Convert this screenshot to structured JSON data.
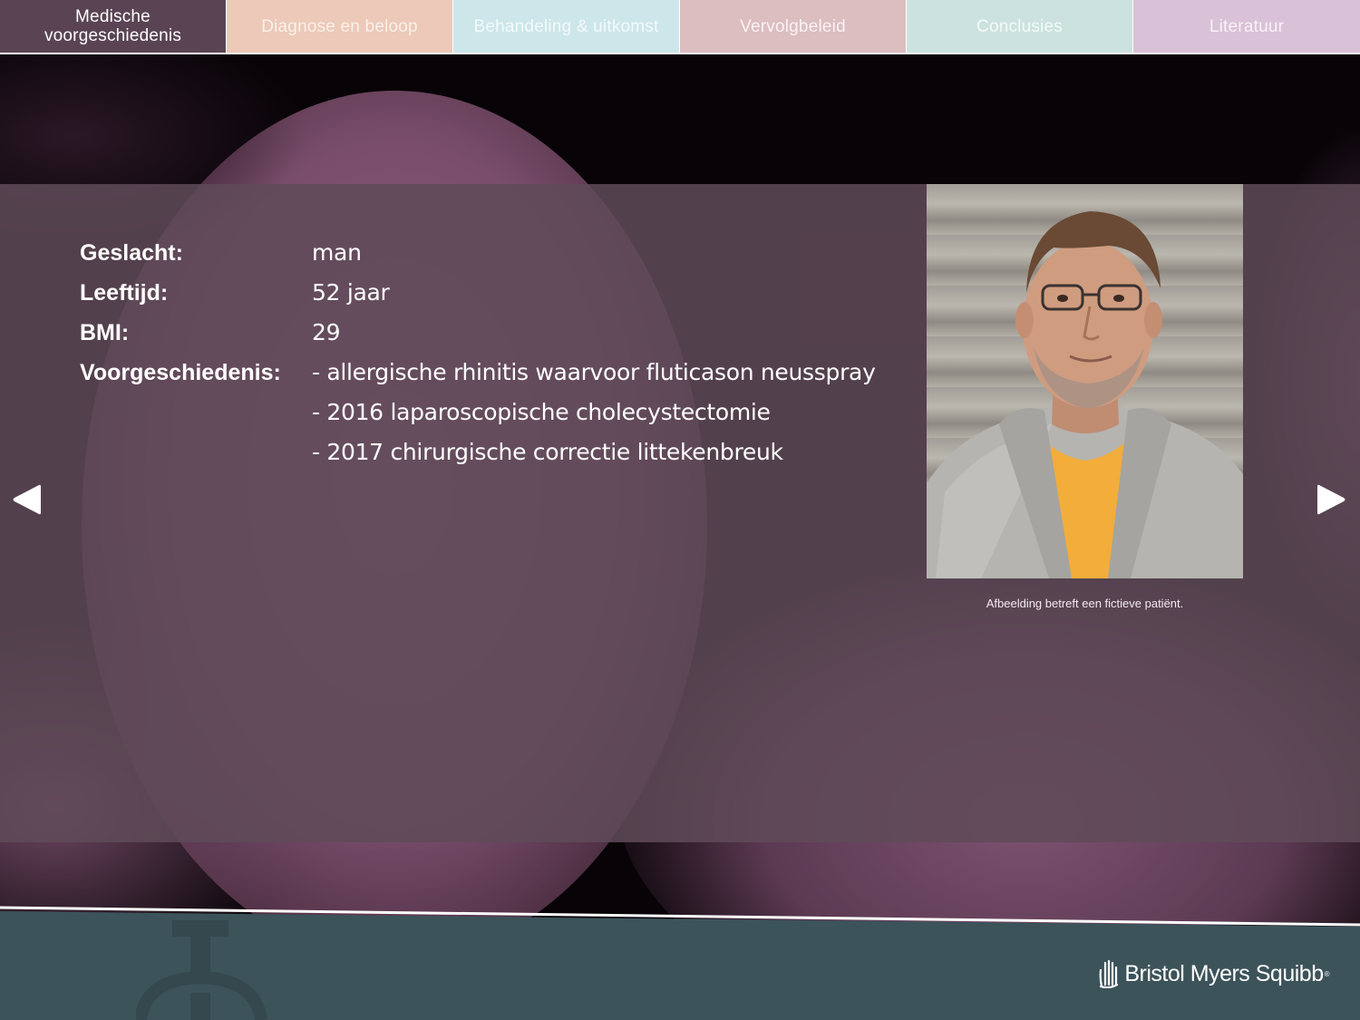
{
  "nav": {
    "tabs": [
      {
        "label": "Medische\nvoorgeschiedenis",
        "active": true
      },
      {
        "label": "Diagnose en beloop",
        "active": false
      },
      {
        "label": "Behandeling & uitkomst",
        "active": false
      },
      {
        "label": "Vervolgbeleid",
        "active": false
      },
      {
        "label": "Conclusies",
        "active": false
      },
      {
        "label": "Literatuur",
        "active": false
      }
    ]
  },
  "patient": {
    "gender_label": "Geslacht:",
    "gender_value": "man",
    "age_label": "Leeftijd:",
    "age_value": "52 jaar",
    "bmi_label": "BMI:",
    "bmi_value": "29",
    "history_label": "Voorgeschiedenis:",
    "history": [
      "- allergische rhinitis waarvoor fluticason neusspray",
      "- 2016 laparoscopische cholecystectomie",
      "- 2017 chirurgische correctie littekenbreuk"
    ],
    "photo_caption": "Afbeelding betreft een fictieve patiënt."
  },
  "footer": {
    "brand": "Bristol Myers Squibb",
    "brand_mark": "®"
  },
  "colors": {
    "panel": "#604a58",
    "footer": "#3c535a",
    "tab_active": "#5a4453",
    "tab_diagnose": "#ecc9b8",
    "tab_behandeling": "#cde6ea",
    "tab_vervolg": "#dcbdc0",
    "tab_conclusies": "#cce2de",
    "tab_literatuur": "#d9c1d7"
  },
  "icons": {
    "prev": "triangle-left-icon",
    "next": "triangle-right-icon",
    "brand": "hand-logo-icon"
  }
}
